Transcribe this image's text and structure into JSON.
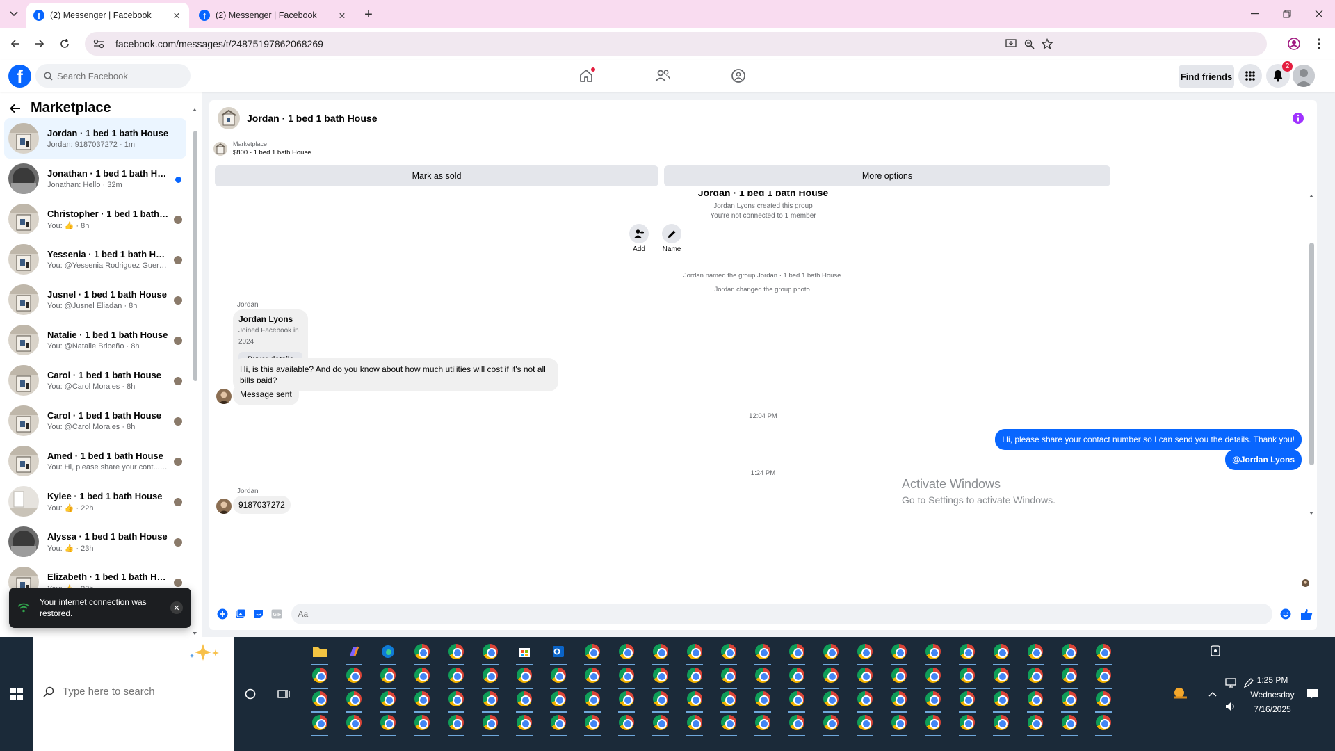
{
  "browser": {
    "tabs": [
      {
        "title": "(2) Messenger | Facebook",
        "active": true
      },
      {
        "title": "(2) Messenger | Facebook",
        "active": false
      }
    ],
    "url": "facebook.com/messages/t/24875197862068269"
  },
  "fb_header": {
    "search_placeholder": "Search Facebook",
    "find_friends_label": "Find friends",
    "notification_count": "2"
  },
  "sidebar": {
    "title": "Marketplace",
    "conversations": [
      {
        "name": "Jordan · 1 bed 1 bath House",
        "preview": "Jordan: 9187037272 · 1m",
        "selected": true,
        "unread": false,
        "thumb": "house"
      },
      {
        "name": "Jonathan · 1 bed 1 bath House",
        "preview": "Jonathan: Hello · 32m",
        "selected": false,
        "unread": true,
        "thumb": "dark"
      },
      {
        "name": "Christopher · 1 bed 1 bath Ho...",
        "preview": "You: 👍 · 8h",
        "selected": false,
        "unread": false,
        "thumb": "house"
      },
      {
        "name": "Yessenia · 1 bed 1 bath House",
        "preview": "You: @Yessenia Rodriguez Guerrero · 8h",
        "selected": false,
        "unread": false,
        "thumb": "house"
      },
      {
        "name": "Jusnel · 1 bed 1 bath House",
        "preview": "You: @Jusnel Eliadan · 8h",
        "selected": false,
        "unread": false,
        "thumb": "house"
      },
      {
        "name": "Natalie · 1 bed 1 bath House",
        "preview": "You: @Natalie Briceño · 8h",
        "selected": false,
        "unread": false,
        "thumb": "house"
      },
      {
        "name": "Carol · 1 bed 1 bath House",
        "preview": "You: @Carol Morales · 8h",
        "selected": false,
        "unread": false,
        "thumb": "house"
      },
      {
        "name": "Carol · 1 bed 1 bath House",
        "preview": "You: @Carol Morales · 8h",
        "selected": false,
        "unread": false,
        "thumb": "house"
      },
      {
        "name": "Amed · 1 bed 1 bath House",
        "preview": "You: Hi, please share your cont... · 22h",
        "selected": false,
        "unread": false,
        "thumb": "house"
      },
      {
        "name": "Kylee · 1 bed 1 bath House",
        "preview": "You: 👍 · 22h",
        "selected": false,
        "unread": false,
        "thumb": "room"
      },
      {
        "name": "Alyssa · 1 bed 1 bath House",
        "preview": "You: 👍 · 23h",
        "selected": false,
        "unread": false,
        "thumb": "dark"
      },
      {
        "name": "Elizabeth · 1 bed 1 bath House",
        "preview": "You: 👍 · 23h",
        "selected": false,
        "unread": false,
        "thumb": "house"
      }
    ]
  },
  "toast": {
    "message": "Your internet connection was restored."
  },
  "chat": {
    "title": "Jordan · 1 bed 1 bath House",
    "listing_label": "Marketplace",
    "listing_detail": "$800 - 1 bed 1 bath House",
    "mark_sold_label": "Mark as sold",
    "more_options_label": "More options",
    "group_title": "Jordan · 1 bed 1 bath House",
    "created_text": "Jordan Lyons created this group",
    "connected_text": "You're not connected to 1 member",
    "add_label": "Add",
    "name_label": "Name",
    "event1": "Jordan named the group Jordan · 1 bed 1 bath House.",
    "event2": "Jordan changed the group photo.",
    "sender1": "Jordan",
    "buyer_name": "Jordan Lyons",
    "buyer_joined": "Joined Facebook in 2024",
    "buyer_details_label": "Buyer details",
    "msg_question": "Hi, is this available? And do you know about how much utilities will cost if it's not all bills paid?",
    "msg_sent": "Message sent",
    "time1": "12:04 PM",
    "out_msg1": "Hi, please share your contact number so I can send you the details. Thank you!",
    "out_msg2": "@Jordan Lyons",
    "time2": "1:24 PM",
    "sender2": "Jordan",
    "msg_phone": "9187037272",
    "composer_placeholder": "Aa"
  },
  "watermark": {
    "line1": "Activate Windows",
    "line2": "Go to Settings to activate Windows."
  },
  "taskbar": {
    "search_placeholder": "Type here to search",
    "time": "1:25 PM",
    "day": "Wednesday",
    "date": "7/16/2025"
  }
}
